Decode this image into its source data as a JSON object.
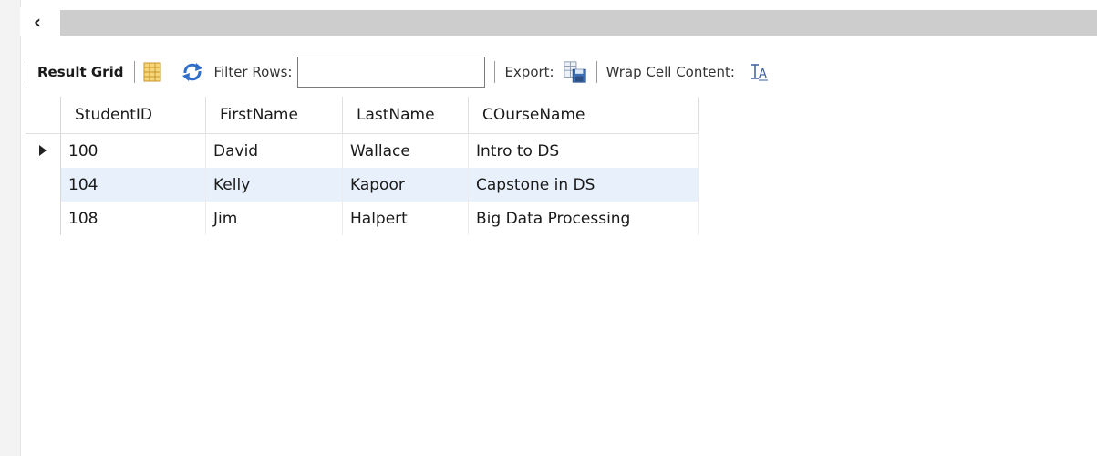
{
  "toolbar": {
    "result_grid_label": "Result Grid",
    "filter_rows_label": "Filter Rows:",
    "filter_rows_value": "",
    "export_label": "Export:",
    "wrap_cell_label": "Wrap Cell Content:"
  },
  "icons": {
    "scroll_left": "chevron-left-icon",
    "grid_view": "grid-layout-icon",
    "refresh": "refresh-icon",
    "export": "export-save-icon",
    "wrap": "wrap-text-icon"
  },
  "colors": {
    "selected_row": "#e8f0fb",
    "scroll_track": "#cdcdcd",
    "refresh_blue": "#2f6fc9",
    "grid_icon_yellow": "#e8b93a"
  },
  "grid": {
    "columns": [
      "StudentID",
      "FirstName",
      "LastName",
      "COurseName"
    ],
    "rows": [
      {
        "cells": [
          "100",
          "David",
          "Wallace",
          "Intro to DS"
        ],
        "current": true
      },
      {
        "cells": [
          "104",
          "Kelly",
          "Kapoor",
          "Capstone in DS"
        ],
        "current": false
      },
      {
        "cells": [
          "108",
          "Jim",
          "Halpert",
          "Big Data Processing"
        ],
        "current": false
      }
    ]
  }
}
